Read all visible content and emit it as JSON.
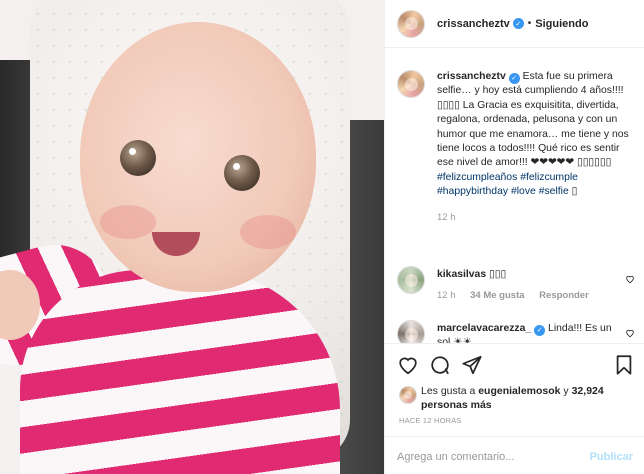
{
  "header": {
    "username": "crissancheztv",
    "verified_mark": "✓",
    "separator": "•",
    "follow_label": "Siguiendo"
  },
  "caption": {
    "username": "crissancheztv",
    "text": " Esta fue su primera selfie… y hoy está cumpliendo 4 años!!!! ▯▯▯▯ La Gracia es exquisitita, divertida, regalona, ordenada, pelusona y con un humor que me enamora… me tiene y nos tiene locos a todos!!!! Qué rico es sentir ese nivel de amor!!! ❤❤❤❤❤ ▯▯▯▯▯▯ ",
    "hashtags": [
      "#felizcumpleaños",
      "#felizcumple",
      "#happybirthday",
      "#love",
      "#selfie"
    ],
    "tail": " ▯",
    "time": "12 h"
  },
  "comments": [
    {
      "username": "kikasilvas",
      "text": " ▯▯▯",
      "time": "12 h",
      "likes": "34 Me gusta",
      "reply": "Responder"
    },
    {
      "username": "marcelavacarezza_",
      "text": " Linda!!! Es un sol ☀☀"
    }
  ],
  "likes": {
    "prefix": "Les gusta a ",
    "user": "eugenialemosok",
    "middle": " y ",
    "count": "32,924 personas más"
  },
  "timestamp": "HACE 12 HORAS",
  "comment_box": {
    "placeholder": "Agrega un comentario...",
    "post_label": "Publicar"
  },
  "icons": [
    "heart-icon",
    "comment-icon",
    "share-icon",
    "bookmark-icon"
  ],
  "colors": {
    "link": "#003569",
    "verified": "#3897f0",
    "post_button": "#b2dffc",
    "muted": "#999999"
  }
}
